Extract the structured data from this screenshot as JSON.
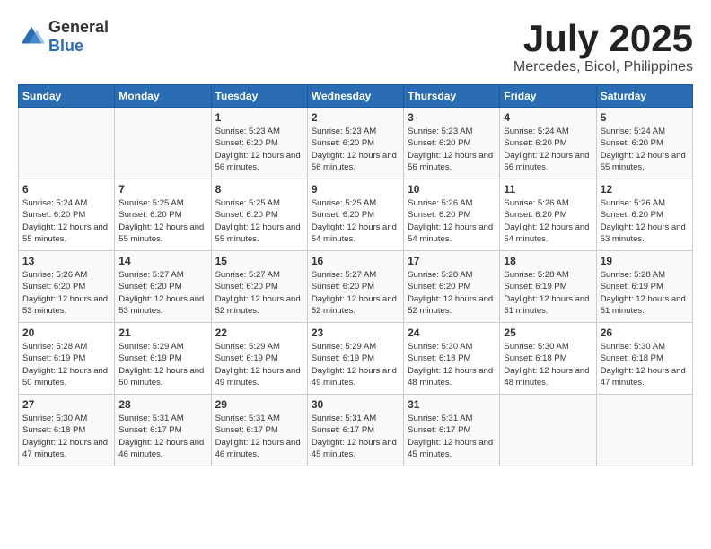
{
  "logo": {
    "general": "General",
    "blue": "Blue"
  },
  "title": {
    "month": "July 2025",
    "location": "Mercedes, Bicol, Philippines"
  },
  "weekdays": [
    "Sunday",
    "Monday",
    "Tuesday",
    "Wednesday",
    "Thursday",
    "Friday",
    "Saturday"
  ],
  "weeks": [
    [
      {
        "day": "",
        "info": ""
      },
      {
        "day": "",
        "info": ""
      },
      {
        "day": "1",
        "info": "Sunrise: 5:23 AM\nSunset: 6:20 PM\nDaylight: 12 hours and 56 minutes."
      },
      {
        "day": "2",
        "info": "Sunrise: 5:23 AM\nSunset: 6:20 PM\nDaylight: 12 hours and 56 minutes."
      },
      {
        "day": "3",
        "info": "Sunrise: 5:23 AM\nSunset: 6:20 PM\nDaylight: 12 hours and 56 minutes."
      },
      {
        "day": "4",
        "info": "Sunrise: 5:24 AM\nSunset: 6:20 PM\nDaylight: 12 hours and 56 minutes."
      },
      {
        "day": "5",
        "info": "Sunrise: 5:24 AM\nSunset: 6:20 PM\nDaylight: 12 hours and 55 minutes."
      }
    ],
    [
      {
        "day": "6",
        "info": "Sunrise: 5:24 AM\nSunset: 6:20 PM\nDaylight: 12 hours and 55 minutes."
      },
      {
        "day": "7",
        "info": "Sunrise: 5:25 AM\nSunset: 6:20 PM\nDaylight: 12 hours and 55 minutes."
      },
      {
        "day": "8",
        "info": "Sunrise: 5:25 AM\nSunset: 6:20 PM\nDaylight: 12 hours and 55 minutes."
      },
      {
        "day": "9",
        "info": "Sunrise: 5:25 AM\nSunset: 6:20 PM\nDaylight: 12 hours and 54 minutes."
      },
      {
        "day": "10",
        "info": "Sunrise: 5:26 AM\nSunset: 6:20 PM\nDaylight: 12 hours and 54 minutes."
      },
      {
        "day": "11",
        "info": "Sunrise: 5:26 AM\nSunset: 6:20 PM\nDaylight: 12 hours and 54 minutes."
      },
      {
        "day": "12",
        "info": "Sunrise: 5:26 AM\nSunset: 6:20 PM\nDaylight: 12 hours and 53 minutes."
      }
    ],
    [
      {
        "day": "13",
        "info": "Sunrise: 5:26 AM\nSunset: 6:20 PM\nDaylight: 12 hours and 53 minutes."
      },
      {
        "day": "14",
        "info": "Sunrise: 5:27 AM\nSunset: 6:20 PM\nDaylight: 12 hours and 53 minutes."
      },
      {
        "day": "15",
        "info": "Sunrise: 5:27 AM\nSunset: 6:20 PM\nDaylight: 12 hours and 52 minutes."
      },
      {
        "day": "16",
        "info": "Sunrise: 5:27 AM\nSunset: 6:20 PM\nDaylight: 12 hours and 52 minutes."
      },
      {
        "day": "17",
        "info": "Sunrise: 5:28 AM\nSunset: 6:20 PM\nDaylight: 12 hours and 52 minutes."
      },
      {
        "day": "18",
        "info": "Sunrise: 5:28 AM\nSunset: 6:19 PM\nDaylight: 12 hours and 51 minutes."
      },
      {
        "day": "19",
        "info": "Sunrise: 5:28 AM\nSunset: 6:19 PM\nDaylight: 12 hours and 51 minutes."
      }
    ],
    [
      {
        "day": "20",
        "info": "Sunrise: 5:28 AM\nSunset: 6:19 PM\nDaylight: 12 hours and 50 minutes."
      },
      {
        "day": "21",
        "info": "Sunrise: 5:29 AM\nSunset: 6:19 PM\nDaylight: 12 hours and 50 minutes."
      },
      {
        "day": "22",
        "info": "Sunrise: 5:29 AM\nSunset: 6:19 PM\nDaylight: 12 hours and 49 minutes."
      },
      {
        "day": "23",
        "info": "Sunrise: 5:29 AM\nSunset: 6:19 PM\nDaylight: 12 hours and 49 minutes."
      },
      {
        "day": "24",
        "info": "Sunrise: 5:30 AM\nSunset: 6:18 PM\nDaylight: 12 hours and 48 minutes."
      },
      {
        "day": "25",
        "info": "Sunrise: 5:30 AM\nSunset: 6:18 PM\nDaylight: 12 hours and 48 minutes."
      },
      {
        "day": "26",
        "info": "Sunrise: 5:30 AM\nSunset: 6:18 PM\nDaylight: 12 hours and 47 minutes."
      }
    ],
    [
      {
        "day": "27",
        "info": "Sunrise: 5:30 AM\nSunset: 6:18 PM\nDaylight: 12 hours and 47 minutes."
      },
      {
        "day": "28",
        "info": "Sunrise: 5:31 AM\nSunset: 6:17 PM\nDaylight: 12 hours and 46 minutes."
      },
      {
        "day": "29",
        "info": "Sunrise: 5:31 AM\nSunset: 6:17 PM\nDaylight: 12 hours and 46 minutes."
      },
      {
        "day": "30",
        "info": "Sunrise: 5:31 AM\nSunset: 6:17 PM\nDaylight: 12 hours and 45 minutes."
      },
      {
        "day": "31",
        "info": "Sunrise: 5:31 AM\nSunset: 6:17 PM\nDaylight: 12 hours and 45 minutes."
      },
      {
        "day": "",
        "info": ""
      },
      {
        "day": "",
        "info": ""
      }
    ]
  ]
}
